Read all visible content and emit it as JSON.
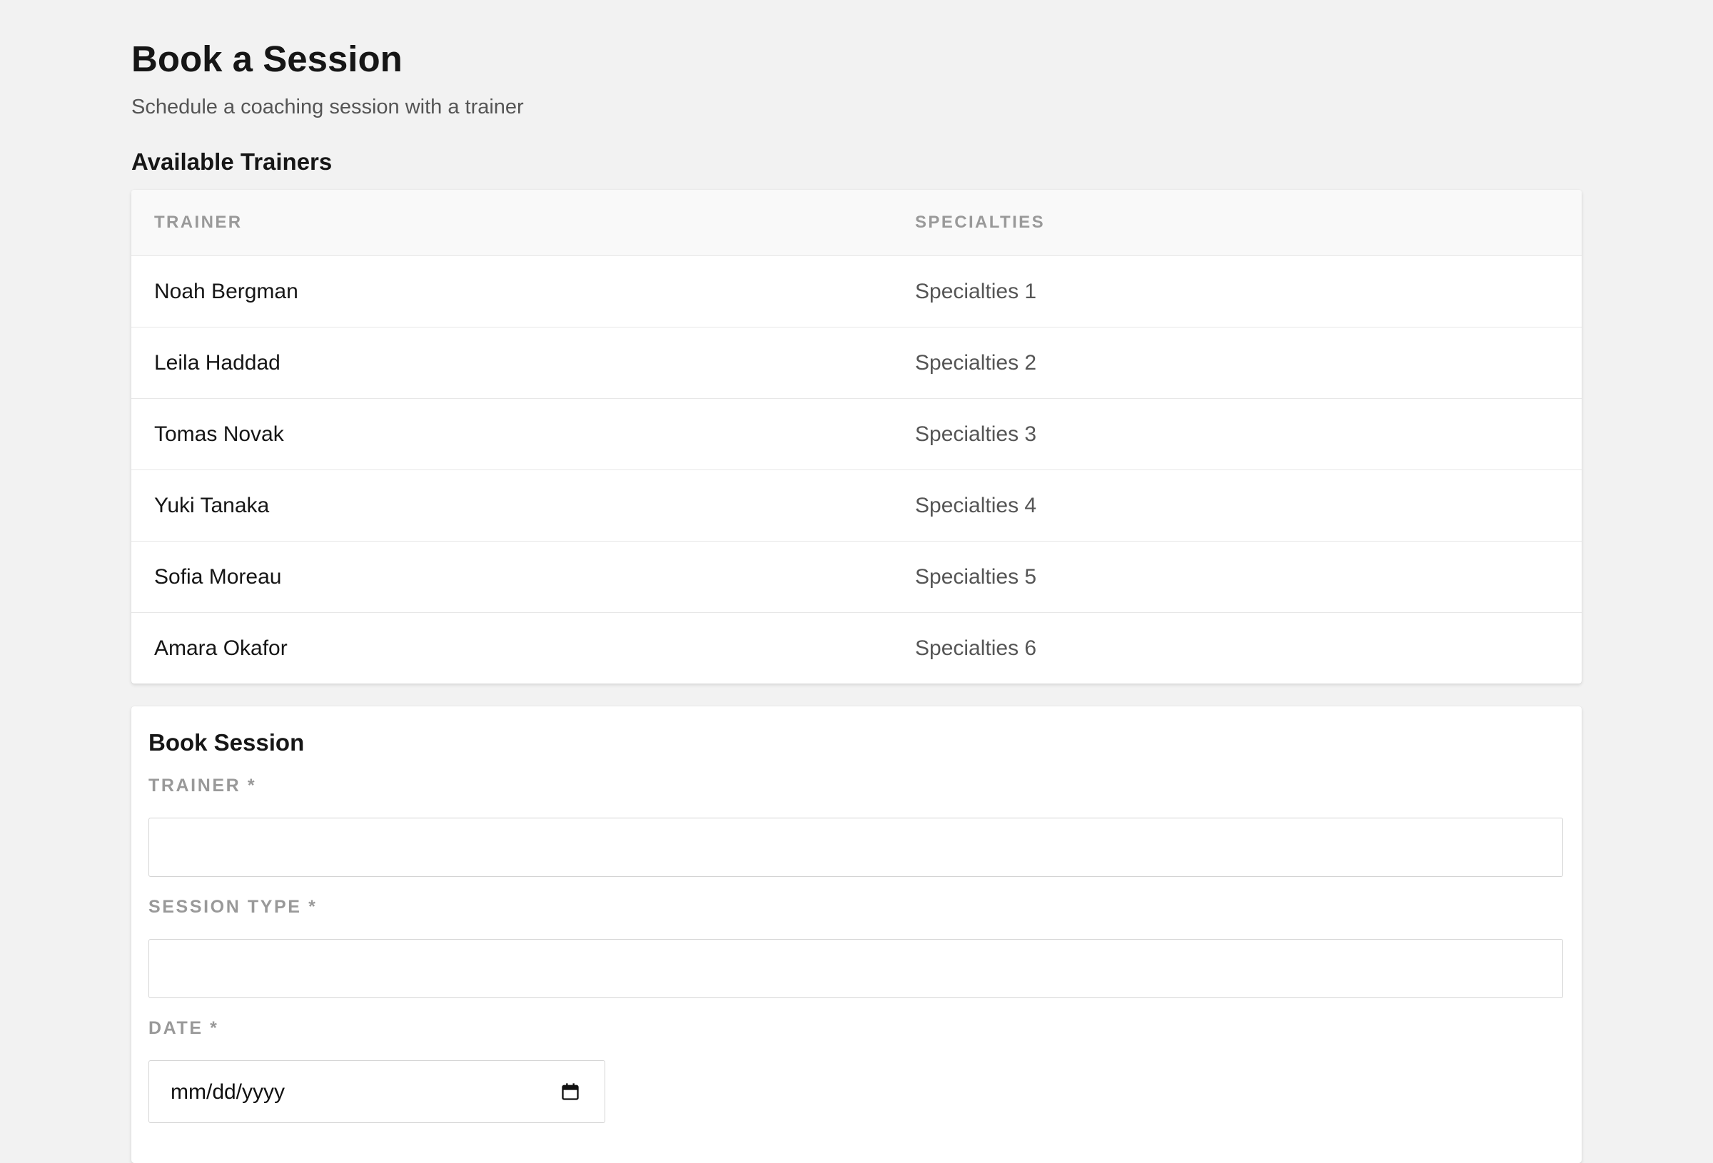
{
  "page": {
    "title": "Book a Session",
    "subtitle": "Schedule a coaching session with a trainer"
  },
  "trainers_section": {
    "heading": "Available Trainers",
    "columns": [
      "TRAINER",
      "SPECIALTIES"
    ],
    "rows": [
      {
        "name": "Noah Bergman",
        "specialties": "Specialties 1"
      },
      {
        "name": "Leila Haddad",
        "specialties": "Specialties 2"
      },
      {
        "name": "Tomas Novak",
        "specialties": "Specialties 3"
      },
      {
        "name": "Yuki Tanaka",
        "specialties": "Specialties 4"
      },
      {
        "name": "Sofia Moreau",
        "specialties": "Specialties 5"
      },
      {
        "name": "Amara Okafor",
        "specialties": "Specialties 6"
      }
    ]
  },
  "booking_form": {
    "heading": "Book Session",
    "trainer": {
      "label": "TRAINER *",
      "value": ""
    },
    "session_type": {
      "label": "SESSION TYPE *",
      "value": ""
    },
    "date": {
      "label": "DATE *",
      "placeholder": "mm/dd/yyyy",
      "icon": "calendar-icon"
    }
  }
}
